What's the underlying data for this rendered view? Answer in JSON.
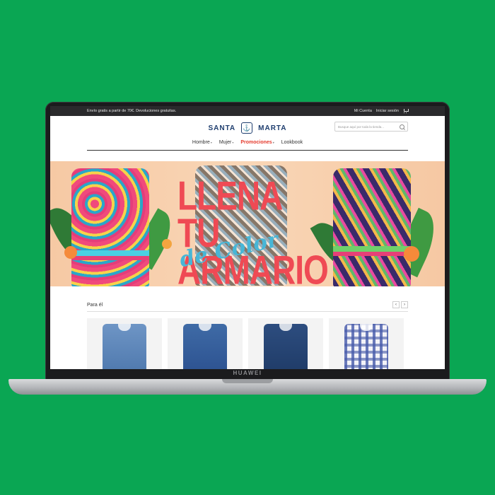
{
  "topbar": {
    "shipping_notice": "Envío gratis a partir de 70€. Devoluciones gratuitas.",
    "account_link": "Mi Cuenta",
    "login_link": "Iniciar sesión",
    "cart_icon": "cart-icon"
  },
  "header": {
    "brand_left": "SANTA",
    "brand_right": "MARTA",
    "logo_icon": "anchor-icon",
    "search_placeholder": "Busque aquí por toda la tienda..."
  },
  "nav": {
    "items": [
      {
        "label": "Hombre"
      },
      {
        "label": "Mujer"
      },
      {
        "label": "Promociones"
      },
      {
        "label": "Lookbook"
      }
    ]
  },
  "banner": {
    "headline_line1": "LLENA TU",
    "headline_line2": "ARMARIO",
    "headline_script": "de Color"
  },
  "section": {
    "title": "Para él",
    "prev_arrow": "‹",
    "next_arrow": "›"
  },
  "laptop": {
    "brand": "HUAWEI"
  },
  "colors": {
    "background": "#0aa653",
    "brand_navy": "#1e3d6e",
    "promo_red": "#e53b2e",
    "headline_red": "#ef4a54"
  }
}
